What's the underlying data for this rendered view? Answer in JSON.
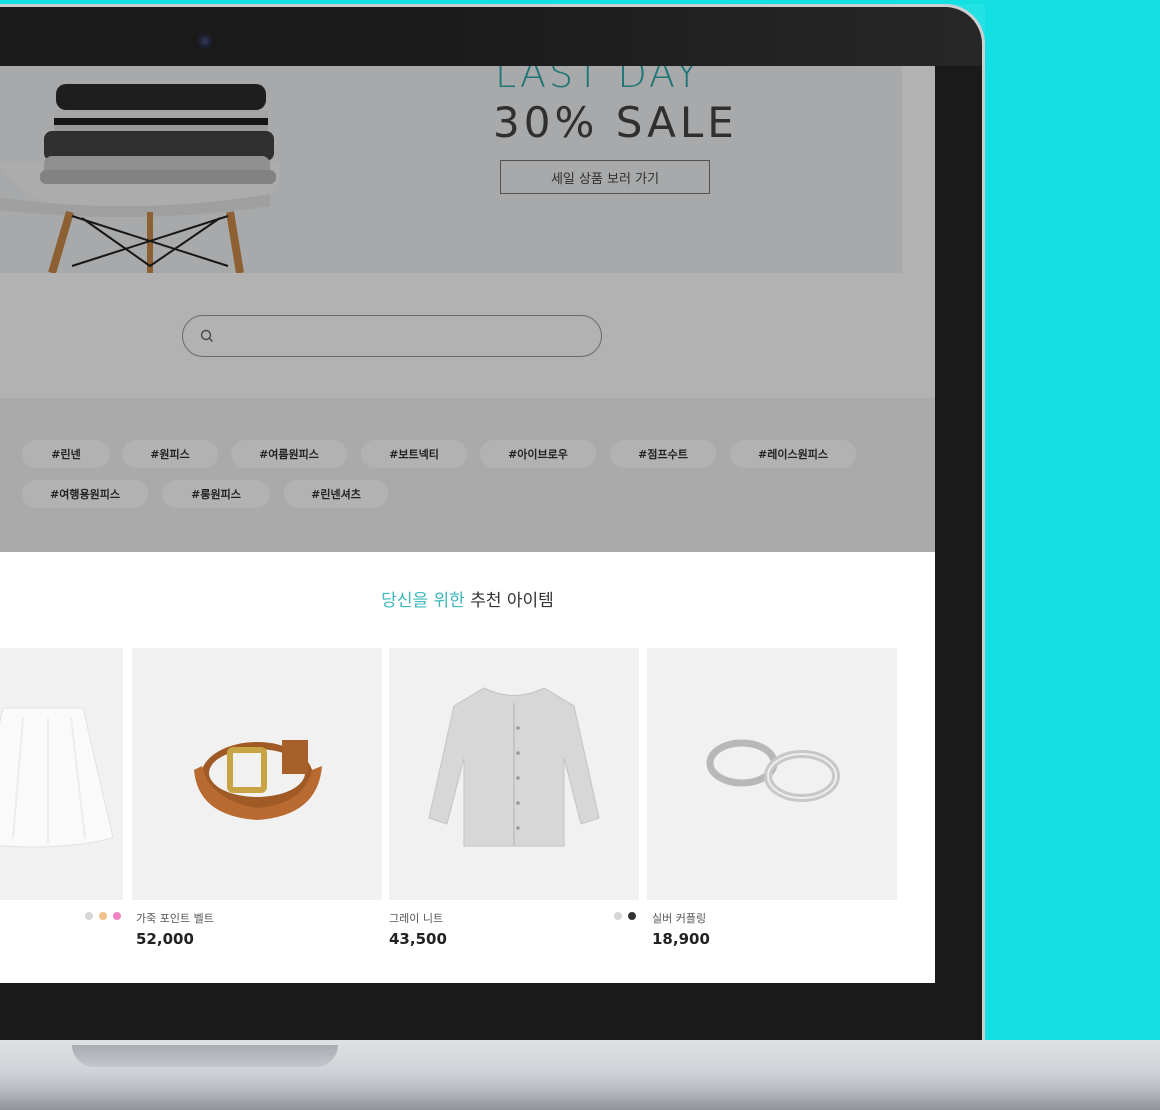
{
  "hero": {
    "headline_top": "LAST DAY",
    "headline_main": "30% SALE",
    "cta_label": "세일 상품 보러 가기"
  },
  "search": {
    "placeholder": ""
  },
  "tags": [
    "#린넨",
    "#원피스",
    "#여름원피스",
    "#보트넥티",
    "#아이브로우",
    "#점프수트",
    "#레이스원피스",
    "#여행용원피스",
    "#롱원피스",
    "#린넨셔츠"
  ],
  "recommend": {
    "title_accent": "당신을 위한",
    "title_rest": " 추천 아이템"
  },
  "products": [
    {
      "name": "",
      "price": "",
      "colors": []
    },
    {
      "name": "가죽 포인트 벨트",
      "price": "52,000",
      "colors": [
        "#d6d6d6",
        "#f0c08a",
        "#f084c0"
      ]
    },
    {
      "name": "그레이 니트",
      "price": "43,500",
      "colors": []
    },
    {
      "name": "실버 커플링",
      "price": "18,900",
      "colors": [
        "#d6d6d6",
        "#333333"
      ]
    }
  ],
  "colors": {
    "background": "#14e0e2",
    "accent": "#3bb7bb"
  }
}
